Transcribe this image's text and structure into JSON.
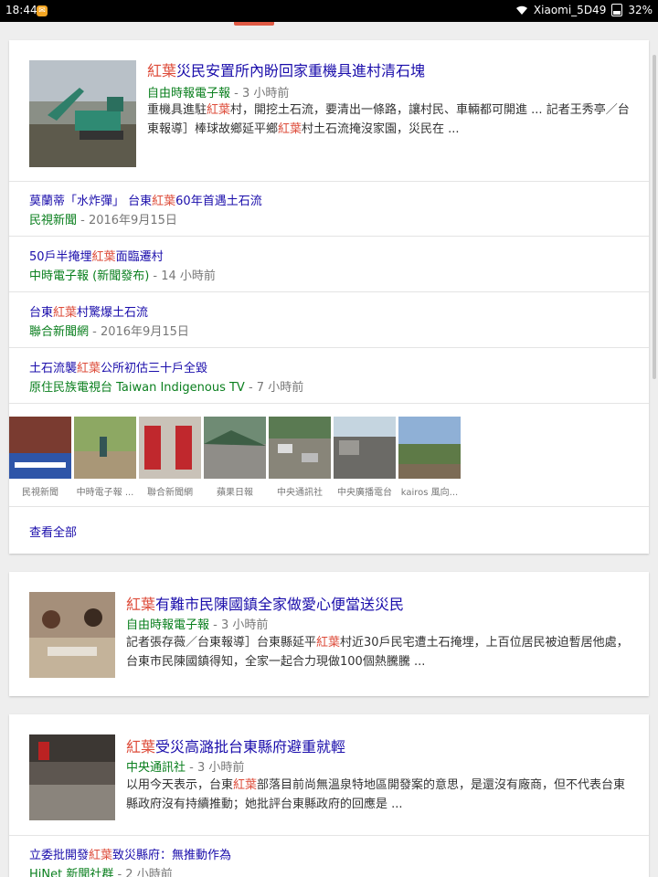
{
  "status_bar": {
    "time": "18:44",
    "notif_glyph": "✉",
    "carrier": "Xiaomi_5D49",
    "battery": "32%"
  },
  "cards": [
    {
      "headline_hl": "紅葉",
      "headline_rest": "災民安置所內盼回家重機具進村清石塊",
      "source": "自由時報電子報",
      "age": " - 3 小時前",
      "snippet_1": "重機具進駐",
      "snippet_hl": "紅葉",
      "snippet_2": "村，開挖土石流，要清出一條路，讓村民、車輛都可開進 ... 記者王秀亭／台東報導］棒球故鄉延平鄉",
      "snippet_hl2": "紅葉",
      "snippet_3": "村土石流掩沒家園，災民在 ..."
    },
    {
      "headline_hl": "紅葉",
      "headline_rest": "有難市民陳國鎮全家做愛心便當送災民",
      "source": "自由時報電子報",
      "age": " - 3 小時前",
      "snippet_1": "記者張存薇／台東報導］台東縣延平",
      "snippet_hl": "紅葉",
      "snippet_2": "村近30戶民宅遭土石掩埋，上百位居民被迫暫居他處，台東市民陳國鎮得知，全家一起合力現做100個熱騰騰 ..."
    },
    {
      "headline_hl": "紅葉",
      "headline_rest": "受災高潞批台東縣府避重就輕",
      "source": "中央通訊社",
      "age": " - 3 小時前",
      "snippet_1": "以用今天表示，台東",
      "snippet_hl": "紅葉",
      "snippet_2": "部落目前尚無溫泉特地區開發案的意思，是還沒有廠商，但不代表台東縣政府沒有持續推動；她批評台東縣政府的回應是 ..."
    }
  ],
  "related": [
    {
      "t1": "莫蘭蒂「水炸彈」 台東",
      "hl": "紅葉",
      "t2": "60年首遇土石流",
      "source": "民視新聞",
      "age": " - 2016年9月15日"
    },
    {
      "t1": "50戶半掩埋",
      "hl": "紅葉",
      "t2": "面臨遷村",
      "source": "中時電子報 (新聞發布)",
      "age": " - 14 小時前"
    },
    {
      "t1": "台東",
      "hl": "紅葉",
      "t2": "村驚爆土石流",
      "source": "聯合新聞網",
      "age": " - 2016年9月15日"
    },
    {
      "t1": "土石流襲",
      "hl": "紅葉",
      "t2": "公所初估三十戶全毀",
      "source": "原住民族電視台 Taiwan Indigenous TV",
      "age": " - 7 小時前"
    }
  ],
  "strip_captions": [
    "民視新聞",
    "中時電子報 ...",
    "聯合新聞網",
    "蘋果日報",
    "中央通訊社",
    "中央廣播電台",
    "kairos 風向..."
  ],
  "view_all": "查看全部",
  "card3_related": {
    "t1": "立委批開發",
    "hl": "紅葉",
    "t2": "致災縣府：無推動作為",
    "source": "HiNet 新聞社群",
    "age": " - 2 小時前"
  }
}
